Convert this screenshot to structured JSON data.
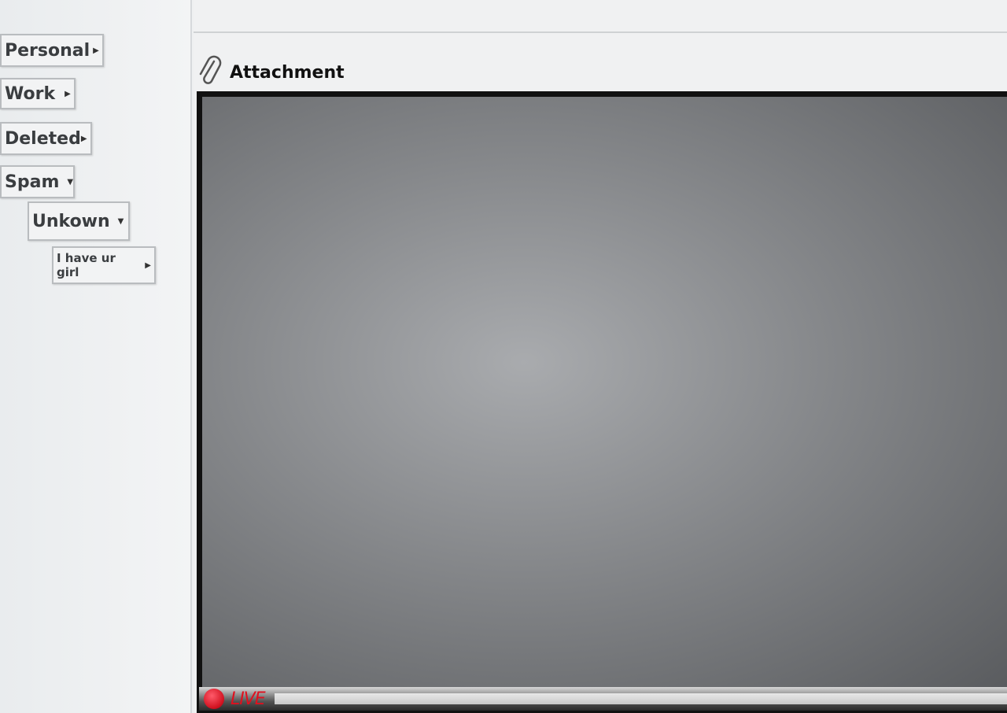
{
  "sidebar": {
    "folders": [
      {
        "label": "Personal",
        "arrow": "▶"
      },
      {
        "label": "Work",
        "arrow": "▶"
      },
      {
        "label": "Deleted",
        "arrow": "▶"
      },
      {
        "label": "Spam",
        "arrow": "▼"
      },
      {
        "label": "Unkown",
        "arrow": "▼"
      },
      {
        "label": "I have ur girl",
        "arrow": "▶"
      }
    ]
  },
  "attachment": {
    "title": "Attachment",
    "live_label": "LIVE"
  },
  "colors": {
    "live": "#e0101e"
  }
}
